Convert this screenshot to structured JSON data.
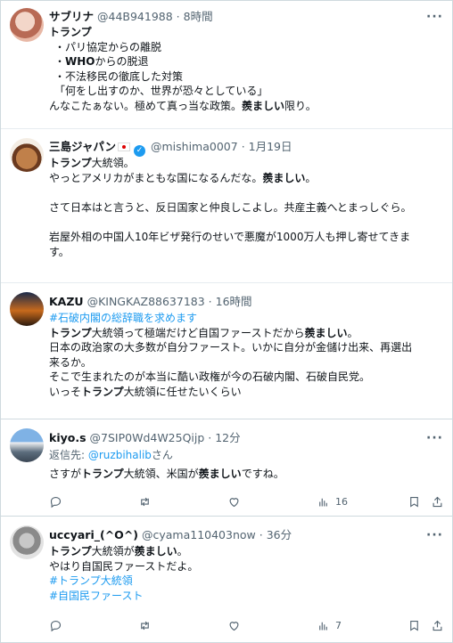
{
  "posts": [
    {
      "name": "サブリナ",
      "handle": "@44B941988",
      "time": "8時間",
      "lines": [
        "トランプ",
        "・パリ協定からの離脱",
        "・WHOからの脱退",
        "・不法移民の徹底した対策",
        "「何をし出すのか、世界が恐々としている」",
        "んなこたぁない。極めて真っ当な政策。羨ましい限り。"
      ]
    },
    {
      "name": "三島ジャパン",
      "handle": "@mishima0007",
      "time": "1月19日",
      "lines": [
        "トランプ大統領。",
        "やっとアメリカがまともな国になるんだな。羨ましい。",
        "",
        "さて日本はと言うと、反日国家と仲良しこよし。共産主義へとまっしぐら。",
        "",
        "岩屋外相の中国人10年ビザ発行のせいで悪魔が1000万人も押し寄せてきま",
        "す。"
      ]
    },
    {
      "name": "KAZU",
      "handle": "@KINGKAZ88637183",
      "time": "16時間",
      "lines": [
        "#石破内閣の総辞職を求めます",
        "トランプ大統領って極端だけど自国ファーストだから羨ましい。",
        "日本の政治家の大多数が自分ファースト。いかに自分が金儲け出来、再選出",
        "来るか。",
        "そこで生まれたのが本当に酷い政権が今の石破内閣、石破自民党。",
        "いっそトランプ大統領に任せたいくらい"
      ]
    },
    {
      "name": "kiyo.s",
      "handle": "@7SIP0Wd4W25Qijp",
      "time": "12分",
      "reply_prefix": "返信先: ",
      "reply_to": "@ruzbihalib",
      "reply_suffix": "さん",
      "lines": [
        "さすがトランプ大統領、米国が羨ましいですね。"
      ],
      "likes": "16"
    },
    {
      "name": "uccyari_(^O^)",
      "handle": "@cyama110403now",
      "time": "36分",
      "lines": [
        "トランプ大統領が羨ましい。",
        "やはり自国民ファーストだよ。",
        "#トランプ大統領",
        "#自国民ファースト"
      ],
      "likes": "7"
    }
  ],
  "ui": {
    "more": "···",
    "sep": " · ",
    "empty": ""
  },
  "colors": {
    "link": "#1d9bf0",
    "muted": "#536471",
    "border": "#cfd9de"
  },
  "icons": [
    "more-icon",
    "verified-badge-icon",
    "japan-flag-icon",
    "reply-icon",
    "retweet-icon",
    "like-icon",
    "views-icon",
    "bookmark-icon",
    "share-icon"
  ]
}
